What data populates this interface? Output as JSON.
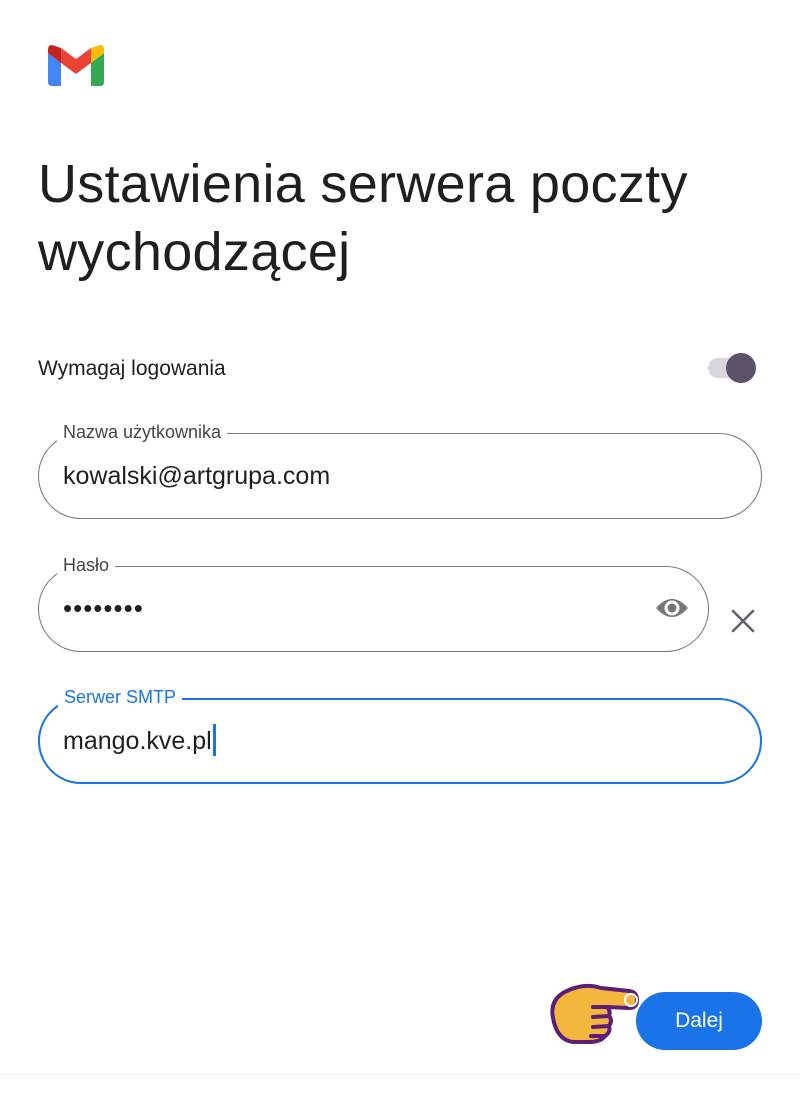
{
  "app": {
    "logo_icon": "gmail-logo-icon"
  },
  "header": {
    "title": "Ustawienia serwera poczty wychodzącej"
  },
  "login_toggle": {
    "label": "Wymagaj logowania",
    "enabled": true
  },
  "fields": {
    "username": {
      "label": "Nazwa użytkownika",
      "value": "kowalski@artgrupa.com"
    },
    "password": {
      "label": "Hasło",
      "value": "••••••••",
      "visibility_icon": "eye-icon",
      "clear_icon": "close-icon"
    },
    "smtp": {
      "label": "Serwer SMTP",
      "value": "mango.kve.pl",
      "focused": true
    }
  },
  "footer": {
    "next_label": "Dalej",
    "pointer_icon": "pointing-hand-icon"
  },
  "colors": {
    "accent": "#1a73e8",
    "toggle_knob": "#5b5369",
    "toggle_track": "#d9d6de",
    "pointer_fill": "#f3b73d",
    "pointer_outline": "#5b1f7a"
  }
}
